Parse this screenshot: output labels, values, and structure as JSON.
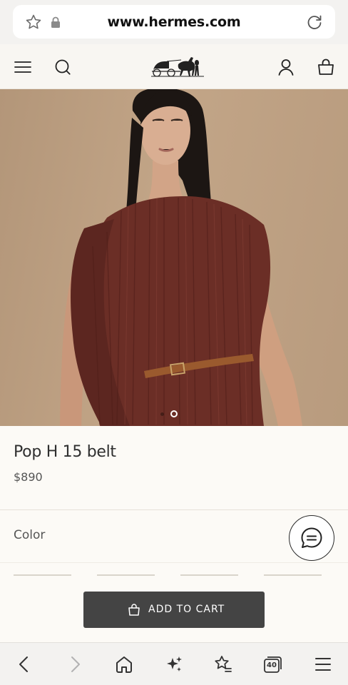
{
  "browser": {
    "url": "www.hermes.com",
    "tab_count": "40"
  },
  "product": {
    "name": "Pop H 15 belt",
    "price": "$890",
    "color_label": "Color"
  },
  "carousel": {
    "total_images": 2,
    "active_index": 2
  },
  "cart": {
    "add_label": "ADD TO CART"
  },
  "icons": {
    "address_bar": [
      "star-icon",
      "lock-icon",
      "reload-icon"
    ],
    "header": [
      "menu-icon",
      "search-icon",
      "hermes-logo",
      "account-icon",
      "bag-icon"
    ],
    "bottom_nav": [
      "back-icon",
      "forward-icon",
      "home-icon",
      "ai-sparkle-icon",
      "bookmarks-icon",
      "tabs-icon",
      "more-menu-icon"
    ]
  },
  "colors": {
    "page_background": "#fcfaf6",
    "cart_button": "#444444",
    "hero_background": "#c2a587",
    "dress": "#6b2e26"
  }
}
